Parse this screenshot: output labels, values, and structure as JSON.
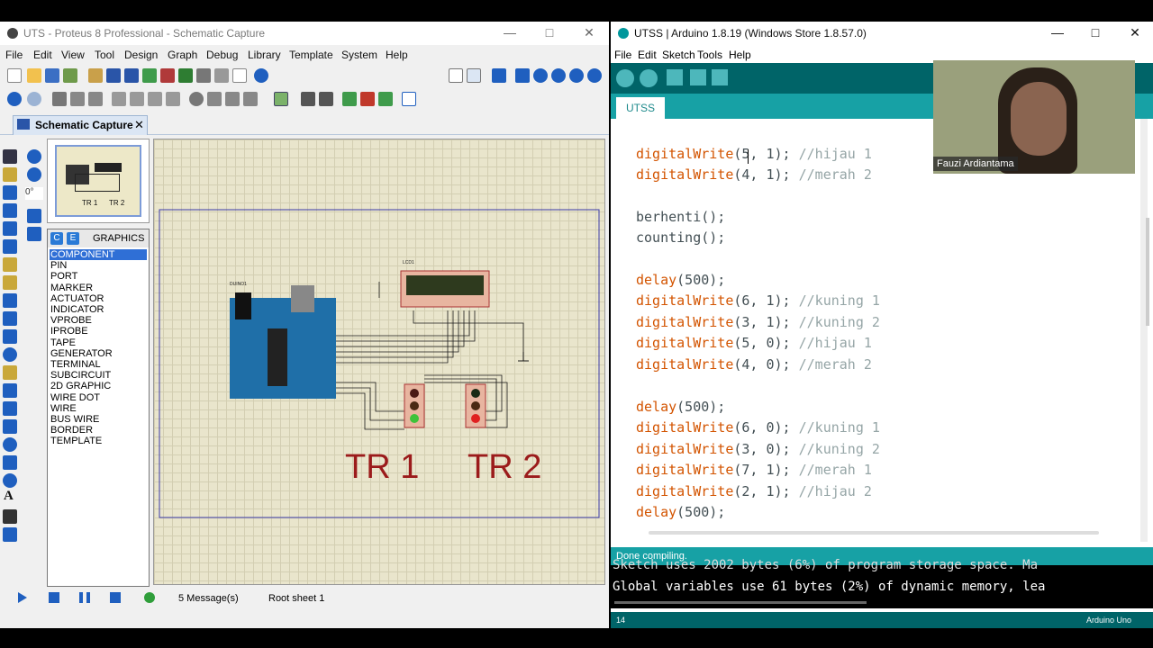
{
  "proteus": {
    "title": "UTS - Proteus 8 Professional - Schematic Capture",
    "menu": [
      "File",
      "Edit",
      "View",
      "Tool",
      "Design",
      "Graph",
      "Debug",
      "Library",
      "Template",
      "System",
      "Help"
    ],
    "tab_label": "Schematic Capture",
    "rotation_value": "0°",
    "modes_header": "GRAPHICS",
    "modes": [
      "COMPONENT",
      "PIN",
      "PORT",
      "MARKER",
      "ACTUATOR",
      "INDICATOR",
      "VPROBE",
      "IPROBE",
      "TAPE",
      "GENERATOR",
      "TERMINAL",
      "SUBCIRCUIT",
      "2D GRAPHIC",
      "WIRE DOT",
      "WIRE",
      "BUS WIRE",
      "BORDER",
      "TEMPLATE"
    ],
    "selected_mode": "COMPONENT",
    "preview_labels": [
      "TR 1",
      "TR 2"
    ],
    "schematic": {
      "arduino_label": "DUINO1",
      "lcd_label": "LCD1",
      "tr1_label": "TR 1",
      "tr2_label": "TR 2"
    },
    "status": {
      "messages": "5 Message(s)",
      "sheet": "Root sheet 1"
    }
  },
  "arduino": {
    "title": "UTSS | Arduino 1.8.19 (Windows Store 1.8.57.0)",
    "menu": [
      "File",
      "Edit",
      "Sketch",
      "Tools",
      "Help"
    ],
    "tab": "UTSS",
    "code": [
      {
        "fn": "digitalWrite",
        "args": "(5, 1);",
        "comment": "//hijau 1"
      },
      {
        "fn": "digitalWrite",
        "args": "(4, 1);",
        "comment": "//merah 2"
      },
      {
        "fn": "",
        "args": "",
        "comment": ""
      },
      {
        "fn": "",
        "args": "berhenti();",
        "comment": ""
      },
      {
        "fn": "",
        "args": "counting();",
        "comment": ""
      },
      {
        "fn": "",
        "args": "",
        "comment": ""
      },
      {
        "fn": "delay",
        "args": "(500);",
        "comment": ""
      },
      {
        "fn": "digitalWrite",
        "args": "(6, 1);",
        "comment": "//kuning 1"
      },
      {
        "fn": "digitalWrite",
        "args": "(3, 1);",
        "comment": "//kuning 2"
      },
      {
        "fn": "digitalWrite",
        "args": "(5, 0);",
        "comment": "//hijau 1"
      },
      {
        "fn": "digitalWrite",
        "args": "(4, 0);",
        "comment": "//merah 2"
      },
      {
        "fn": "",
        "args": "",
        "comment": ""
      },
      {
        "fn": "delay",
        "args": "(500);",
        "comment": ""
      },
      {
        "fn": "digitalWrite",
        "args": "(6, 0);",
        "comment": "//kuning 1"
      },
      {
        "fn": "digitalWrite",
        "args": "(3, 0);",
        "comment": "//kuning 2"
      },
      {
        "fn": "digitalWrite",
        "args": "(7, 1);",
        "comment": "//merah 1"
      },
      {
        "fn": "digitalWrite",
        "args": "(2, 1);",
        "comment": "//hijau 2"
      },
      {
        "fn": "delay",
        "args": "(500);",
        "comment": ""
      }
    ],
    "status": "Done compiling.",
    "console": [
      "Sketch uses 2002 bytes (6%) of program storage space. Ma",
      "Global variables use 61 bytes (2%) of dynamic memory, lea"
    ],
    "line_number": "14",
    "board": "Arduino Uno"
  },
  "webcam": {
    "name": "Fauzi Ardiantama"
  },
  "colors": {
    "arduino_teal": "#006468",
    "arduino_tab_teal": "#17a1a5",
    "proteus_select": "#2f6fd6",
    "schematic_bg": "#e9e5cc",
    "label_red": "#9b1b1b"
  }
}
